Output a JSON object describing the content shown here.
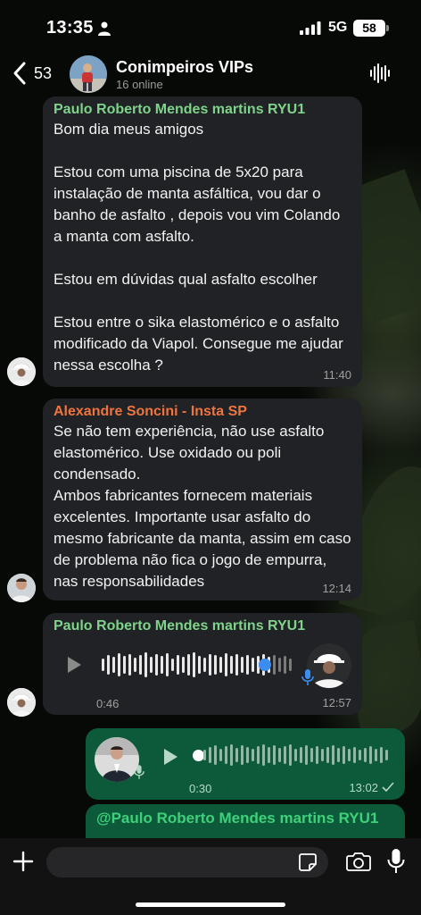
{
  "status": {
    "time": "13:35",
    "network": "5G",
    "battery": "58"
  },
  "header": {
    "back_count": "53",
    "title": "Conimpeiros VIPs",
    "subtitle": "16 online"
  },
  "messages": [
    {
      "sender": "Paulo Roberto Mendes martins RYU1",
      "sender_color": "#7fd38a",
      "text": "Bom dia meus amigos\n\nEstou com uma piscina de 5x20 para instalação de manta asfáltica, vou dar o banho de asfalto , depois vou vim Colando a manta com asfalto.\n\nEstou em dúvidas qual asfalto escolher\n\nEstou entre o sika elastomérico e o asfalto modificado da Viapol. Consegue me ajudar nessa escolha ?",
      "time": "11:40"
    },
    {
      "sender": "Alexandre Soncini - Insta SP",
      "sender_color": "#f0743e",
      "text": "Se não tem experiência, não use asfalto elastomérico. Use oxidado ou poli condensado.\nAmbos fabricantes fornecem materiais excelentes. Importante usar asfalto do mesmo fabricante da manta, assim em caso de problema não fica o jogo de empurra, nas responsabilidades",
      "time": "12:14"
    }
  ],
  "voice_incoming": {
    "sender": "Paulo Roberto Mendes martins RYU1",
    "sender_color": "#7fd38a",
    "duration": "0:46",
    "time": "12:57",
    "progress": 0.88,
    "accent": "#3b8ef0"
  },
  "voice_outgoing": {
    "duration": "0:30",
    "time": "13:02",
    "progress": 0.0
  },
  "reply_preview": {
    "text": "@Paulo Roberto Mendes martins RYU1",
    "color": "#3ed17a"
  },
  "composer": {
    "placeholder": ""
  },
  "icons": [
    "person-icon",
    "signal-icon",
    "back-icon",
    "waveform-icon",
    "play-icon",
    "mic-icon",
    "plus-icon",
    "sticker-icon",
    "camera-icon",
    "checkmark-icon"
  ]
}
